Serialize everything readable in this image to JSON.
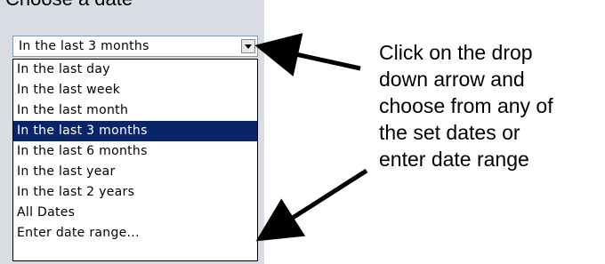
{
  "heading_partial": "Choose a date",
  "date_select": {
    "value": "In the last 3 months"
  },
  "dropdown": {
    "options": [
      "In the last day",
      "In the last week",
      "In the last month",
      "In the last 3 months",
      "In the last 6 months",
      "In the last year",
      "In the last 2 years",
      "All Dates",
      "Enter date range..."
    ],
    "selected_index": 3
  },
  "callout": {
    "lines": [
      "Click on the drop",
      "down arrow and",
      "choose from any of",
      "the set dates or",
      "enter date range"
    ]
  },
  "colors": {
    "selection_bg": "#0a246a",
    "panel_bg": "#d9dde3"
  }
}
